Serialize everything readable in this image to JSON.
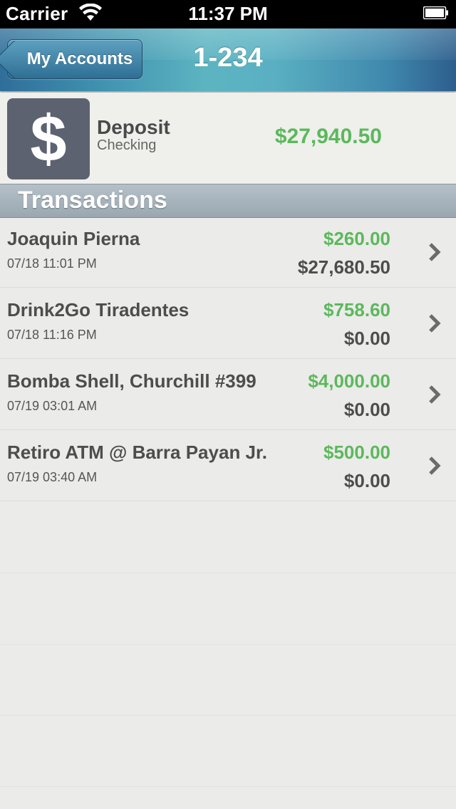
{
  "status_bar": {
    "carrier": "Carrier",
    "time": "11:37 PM",
    "wifi_icon": "wifi-icon",
    "battery_icon": "battery-icon"
  },
  "nav": {
    "back_label": "My Accounts",
    "title": "1-234"
  },
  "account": {
    "icon": "dollar-icon",
    "icon_glyph": "$",
    "name": "Deposit",
    "type": "Checking",
    "balance": "$27,940.50"
  },
  "section": {
    "title": "Transactions"
  },
  "transactions": [
    {
      "name": "Joaquin Pierna",
      "date": "07/18 11:01 PM",
      "amount": "$260.00",
      "balance": "$27,680.50"
    },
    {
      "name": "Drink2Go Tiradentes",
      "date": "07/18 11:16 PM",
      "amount": "$758.60",
      "balance": "$0.00"
    },
    {
      "name": "Bomba Shell, Churchill #399",
      "date": "07/19 03:01 AM",
      "amount": "$4,000.00",
      "balance": "$0.00"
    },
    {
      "name": "Retiro ATM @ Barra Payan Jr.",
      "date": "07/19 03:40 AM",
      "amount": "$500.00",
      "balance": "$0.00"
    }
  ],
  "colors": {
    "positive": "#5cb85c",
    "nav_accent": "#5ab0c2"
  }
}
